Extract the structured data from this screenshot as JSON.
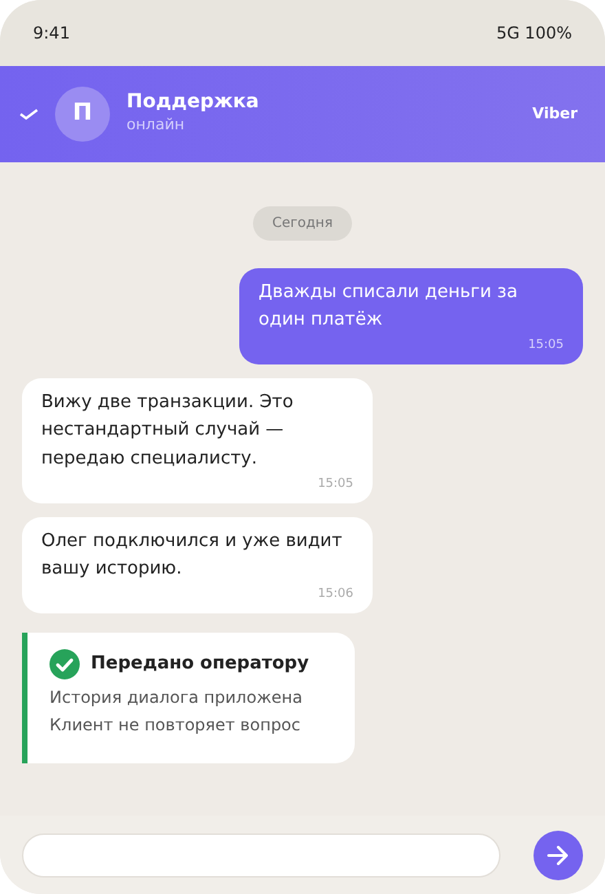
{
  "status_bar": {
    "time": "9:41",
    "signal": "5G 100%"
  },
  "header": {
    "avatar_letter": "П",
    "title": "Поддержка",
    "subtitle": "онлайн",
    "platform": "Viber"
  },
  "date_chip": "Сегодня",
  "messages": [
    {
      "kind": "outgoing",
      "text": "Дважды списали деньги за один платёж",
      "time": "15:05"
    },
    {
      "kind": "incoming",
      "text": "Вижу две транзакции. Это нестандартный случай — передаю специалисту.",
      "time": "15:05"
    },
    {
      "kind": "incoming",
      "text": "Олег подключился и уже видит вашу историю.",
      "time": "15:06"
    },
    {
      "kind": "status",
      "title": "Передано оператору",
      "lines": [
        "История диалога приложена",
        "Клиент не повторяет вопрос"
      ],
      "color": "#27a35a"
    }
  ]
}
